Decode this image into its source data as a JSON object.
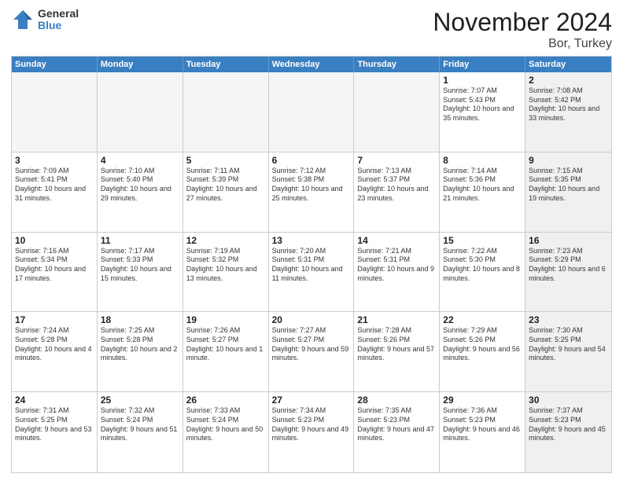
{
  "logo": {
    "general": "General",
    "blue": "Blue"
  },
  "header": {
    "month": "November 2024",
    "location": "Bor, Turkey"
  },
  "weekdays": [
    "Sunday",
    "Monday",
    "Tuesday",
    "Wednesday",
    "Thursday",
    "Friday",
    "Saturday"
  ],
  "rows": [
    [
      {
        "day": "",
        "text": "",
        "empty": true
      },
      {
        "day": "",
        "text": "",
        "empty": true
      },
      {
        "day": "",
        "text": "",
        "empty": true
      },
      {
        "day": "",
        "text": "",
        "empty": true
      },
      {
        "day": "",
        "text": "",
        "empty": true
      },
      {
        "day": "1",
        "text": "Sunrise: 7:07 AM\nSunset: 5:43 PM\nDaylight: 10 hours and 35 minutes.",
        "shaded": false
      },
      {
        "day": "2",
        "text": "Sunrise: 7:08 AM\nSunset: 5:42 PM\nDaylight: 10 hours and 33 minutes.",
        "shaded": true
      }
    ],
    [
      {
        "day": "3",
        "text": "Sunrise: 7:09 AM\nSunset: 5:41 PM\nDaylight: 10 hours and 31 minutes.",
        "shaded": false
      },
      {
        "day": "4",
        "text": "Sunrise: 7:10 AM\nSunset: 5:40 PM\nDaylight: 10 hours and 29 minutes.",
        "shaded": false
      },
      {
        "day": "5",
        "text": "Sunrise: 7:11 AM\nSunset: 5:39 PM\nDaylight: 10 hours and 27 minutes.",
        "shaded": false
      },
      {
        "day": "6",
        "text": "Sunrise: 7:12 AM\nSunset: 5:38 PM\nDaylight: 10 hours and 25 minutes.",
        "shaded": false
      },
      {
        "day": "7",
        "text": "Sunrise: 7:13 AM\nSunset: 5:37 PM\nDaylight: 10 hours and 23 minutes.",
        "shaded": false
      },
      {
        "day": "8",
        "text": "Sunrise: 7:14 AM\nSunset: 5:36 PM\nDaylight: 10 hours and 21 minutes.",
        "shaded": false
      },
      {
        "day": "9",
        "text": "Sunrise: 7:15 AM\nSunset: 5:35 PM\nDaylight: 10 hours and 19 minutes.",
        "shaded": true
      }
    ],
    [
      {
        "day": "10",
        "text": "Sunrise: 7:16 AM\nSunset: 5:34 PM\nDaylight: 10 hours and 17 minutes.",
        "shaded": false
      },
      {
        "day": "11",
        "text": "Sunrise: 7:17 AM\nSunset: 5:33 PM\nDaylight: 10 hours and 15 minutes.",
        "shaded": false
      },
      {
        "day": "12",
        "text": "Sunrise: 7:19 AM\nSunset: 5:32 PM\nDaylight: 10 hours and 13 minutes.",
        "shaded": false
      },
      {
        "day": "13",
        "text": "Sunrise: 7:20 AM\nSunset: 5:31 PM\nDaylight: 10 hours and 11 minutes.",
        "shaded": false
      },
      {
        "day": "14",
        "text": "Sunrise: 7:21 AM\nSunset: 5:31 PM\nDaylight: 10 hours and 9 minutes.",
        "shaded": false
      },
      {
        "day": "15",
        "text": "Sunrise: 7:22 AM\nSunset: 5:30 PM\nDaylight: 10 hours and 8 minutes.",
        "shaded": false
      },
      {
        "day": "16",
        "text": "Sunrise: 7:23 AM\nSunset: 5:29 PM\nDaylight: 10 hours and 6 minutes.",
        "shaded": true
      }
    ],
    [
      {
        "day": "17",
        "text": "Sunrise: 7:24 AM\nSunset: 5:28 PM\nDaylight: 10 hours and 4 minutes.",
        "shaded": false
      },
      {
        "day": "18",
        "text": "Sunrise: 7:25 AM\nSunset: 5:28 PM\nDaylight: 10 hours and 2 minutes.",
        "shaded": false
      },
      {
        "day": "19",
        "text": "Sunrise: 7:26 AM\nSunset: 5:27 PM\nDaylight: 10 hours and 1 minute.",
        "shaded": false
      },
      {
        "day": "20",
        "text": "Sunrise: 7:27 AM\nSunset: 5:27 PM\nDaylight: 9 hours and 59 minutes.",
        "shaded": false
      },
      {
        "day": "21",
        "text": "Sunrise: 7:28 AM\nSunset: 5:26 PM\nDaylight: 9 hours and 57 minutes.",
        "shaded": false
      },
      {
        "day": "22",
        "text": "Sunrise: 7:29 AM\nSunset: 5:26 PM\nDaylight: 9 hours and 56 minutes.",
        "shaded": false
      },
      {
        "day": "23",
        "text": "Sunrise: 7:30 AM\nSunset: 5:25 PM\nDaylight: 9 hours and 54 minutes.",
        "shaded": true
      }
    ],
    [
      {
        "day": "24",
        "text": "Sunrise: 7:31 AM\nSunset: 5:25 PM\nDaylight: 9 hours and 53 minutes.",
        "shaded": false
      },
      {
        "day": "25",
        "text": "Sunrise: 7:32 AM\nSunset: 5:24 PM\nDaylight: 9 hours and 51 minutes.",
        "shaded": false
      },
      {
        "day": "26",
        "text": "Sunrise: 7:33 AM\nSunset: 5:24 PM\nDaylight: 9 hours and 50 minutes.",
        "shaded": false
      },
      {
        "day": "27",
        "text": "Sunrise: 7:34 AM\nSunset: 5:23 PM\nDaylight: 9 hours and 49 minutes.",
        "shaded": false
      },
      {
        "day": "28",
        "text": "Sunrise: 7:35 AM\nSunset: 5:23 PM\nDaylight: 9 hours and 47 minutes.",
        "shaded": false
      },
      {
        "day": "29",
        "text": "Sunrise: 7:36 AM\nSunset: 5:23 PM\nDaylight: 9 hours and 46 minutes.",
        "shaded": false
      },
      {
        "day": "30",
        "text": "Sunrise: 7:37 AM\nSunset: 5:23 PM\nDaylight: 9 hours and 45 minutes.",
        "shaded": true
      }
    ]
  ]
}
